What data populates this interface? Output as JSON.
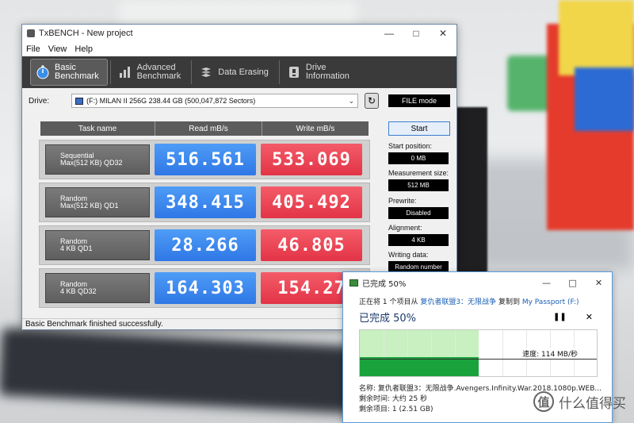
{
  "window": {
    "title": "TxBENCH - New project",
    "menu": [
      "File",
      "View",
      "Help"
    ],
    "tabs": [
      {
        "line1": "Basic",
        "line2": "Benchmark",
        "icon": "stopwatch-icon"
      },
      {
        "line1": "Advanced",
        "line2": "Benchmark",
        "icon": "bar-chart-icon"
      },
      {
        "line1": "Data Erasing",
        "line2": "",
        "icon": "eraser-icon"
      },
      {
        "line1": "Drive",
        "line2": "Information",
        "icon": "drive-info-icon"
      }
    ],
    "drive_label": "Drive:",
    "drive_value": "(F:) MILAN II 256G  238.44 GB (500,047,872 Sectors)",
    "mode": "FILE mode",
    "columns": {
      "task": "Task name",
      "read": "Read mB/s",
      "write": "Write mB/s"
    },
    "rows": [
      {
        "task_l1": "Sequential",
        "task_l2": "Max(512 KB) QD32",
        "read": "516.561",
        "write": "533.069"
      },
      {
        "task_l1": "Random",
        "task_l2": "Max(512 KB) QD1",
        "read": "348.415",
        "write": "405.492"
      },
      {
        "task_l1": "Random",
        "task_l2": "4 KB QD1",
        "read": "28.266",
        "write": "46.805"
      },
      {
        "task_l1": "Random",
        "task_l2": "4 KB QD32",
        "read": "164.303",
        "write": "154.27"
      }
    ],
    "start_button": "Start",
    "settings": [
      {
        "label": "Start position:",
        "value": "0 MB"
      },
      {
        "label": "Measurement size:",
        "value": "512 MB"
      },
      {
        "label": "Prewrite:",
        "value": "Disabled"
      },
      {
        "label": "Alignment:",
        "value": "4 KB"
      },
      {
        "label": "Writing data:",
        "value": "Random number"
      }
    ],
    "status": "Basic Benchmark finished successfully."
  },
  "copy_dialog": {
    "title": "已完成 50%",
    "line_prefix": "正在将 1 个项目从",
    "source": "复仇者联盟3：无限战争",
    "copy_to": "复制到",
    "dest": "My Passport (F:)",
    "percent_text": "已完成 50%",
    "progress": 0.5,
    "speed": "速度: 114 MB/秒",
    "name_line": "名称: 复仇者联盟3：无限战争.Avengers.Infinity.War.2018.1080p.WEB...",
    "time_line": "剩余时间: 大约 25 秒",
    "items_line": "剩余项目: 1 (2.51 GB)"
  },
  "watermark": {
    "icon_char": "值",
    "text": "什么值得买"
  }
}
